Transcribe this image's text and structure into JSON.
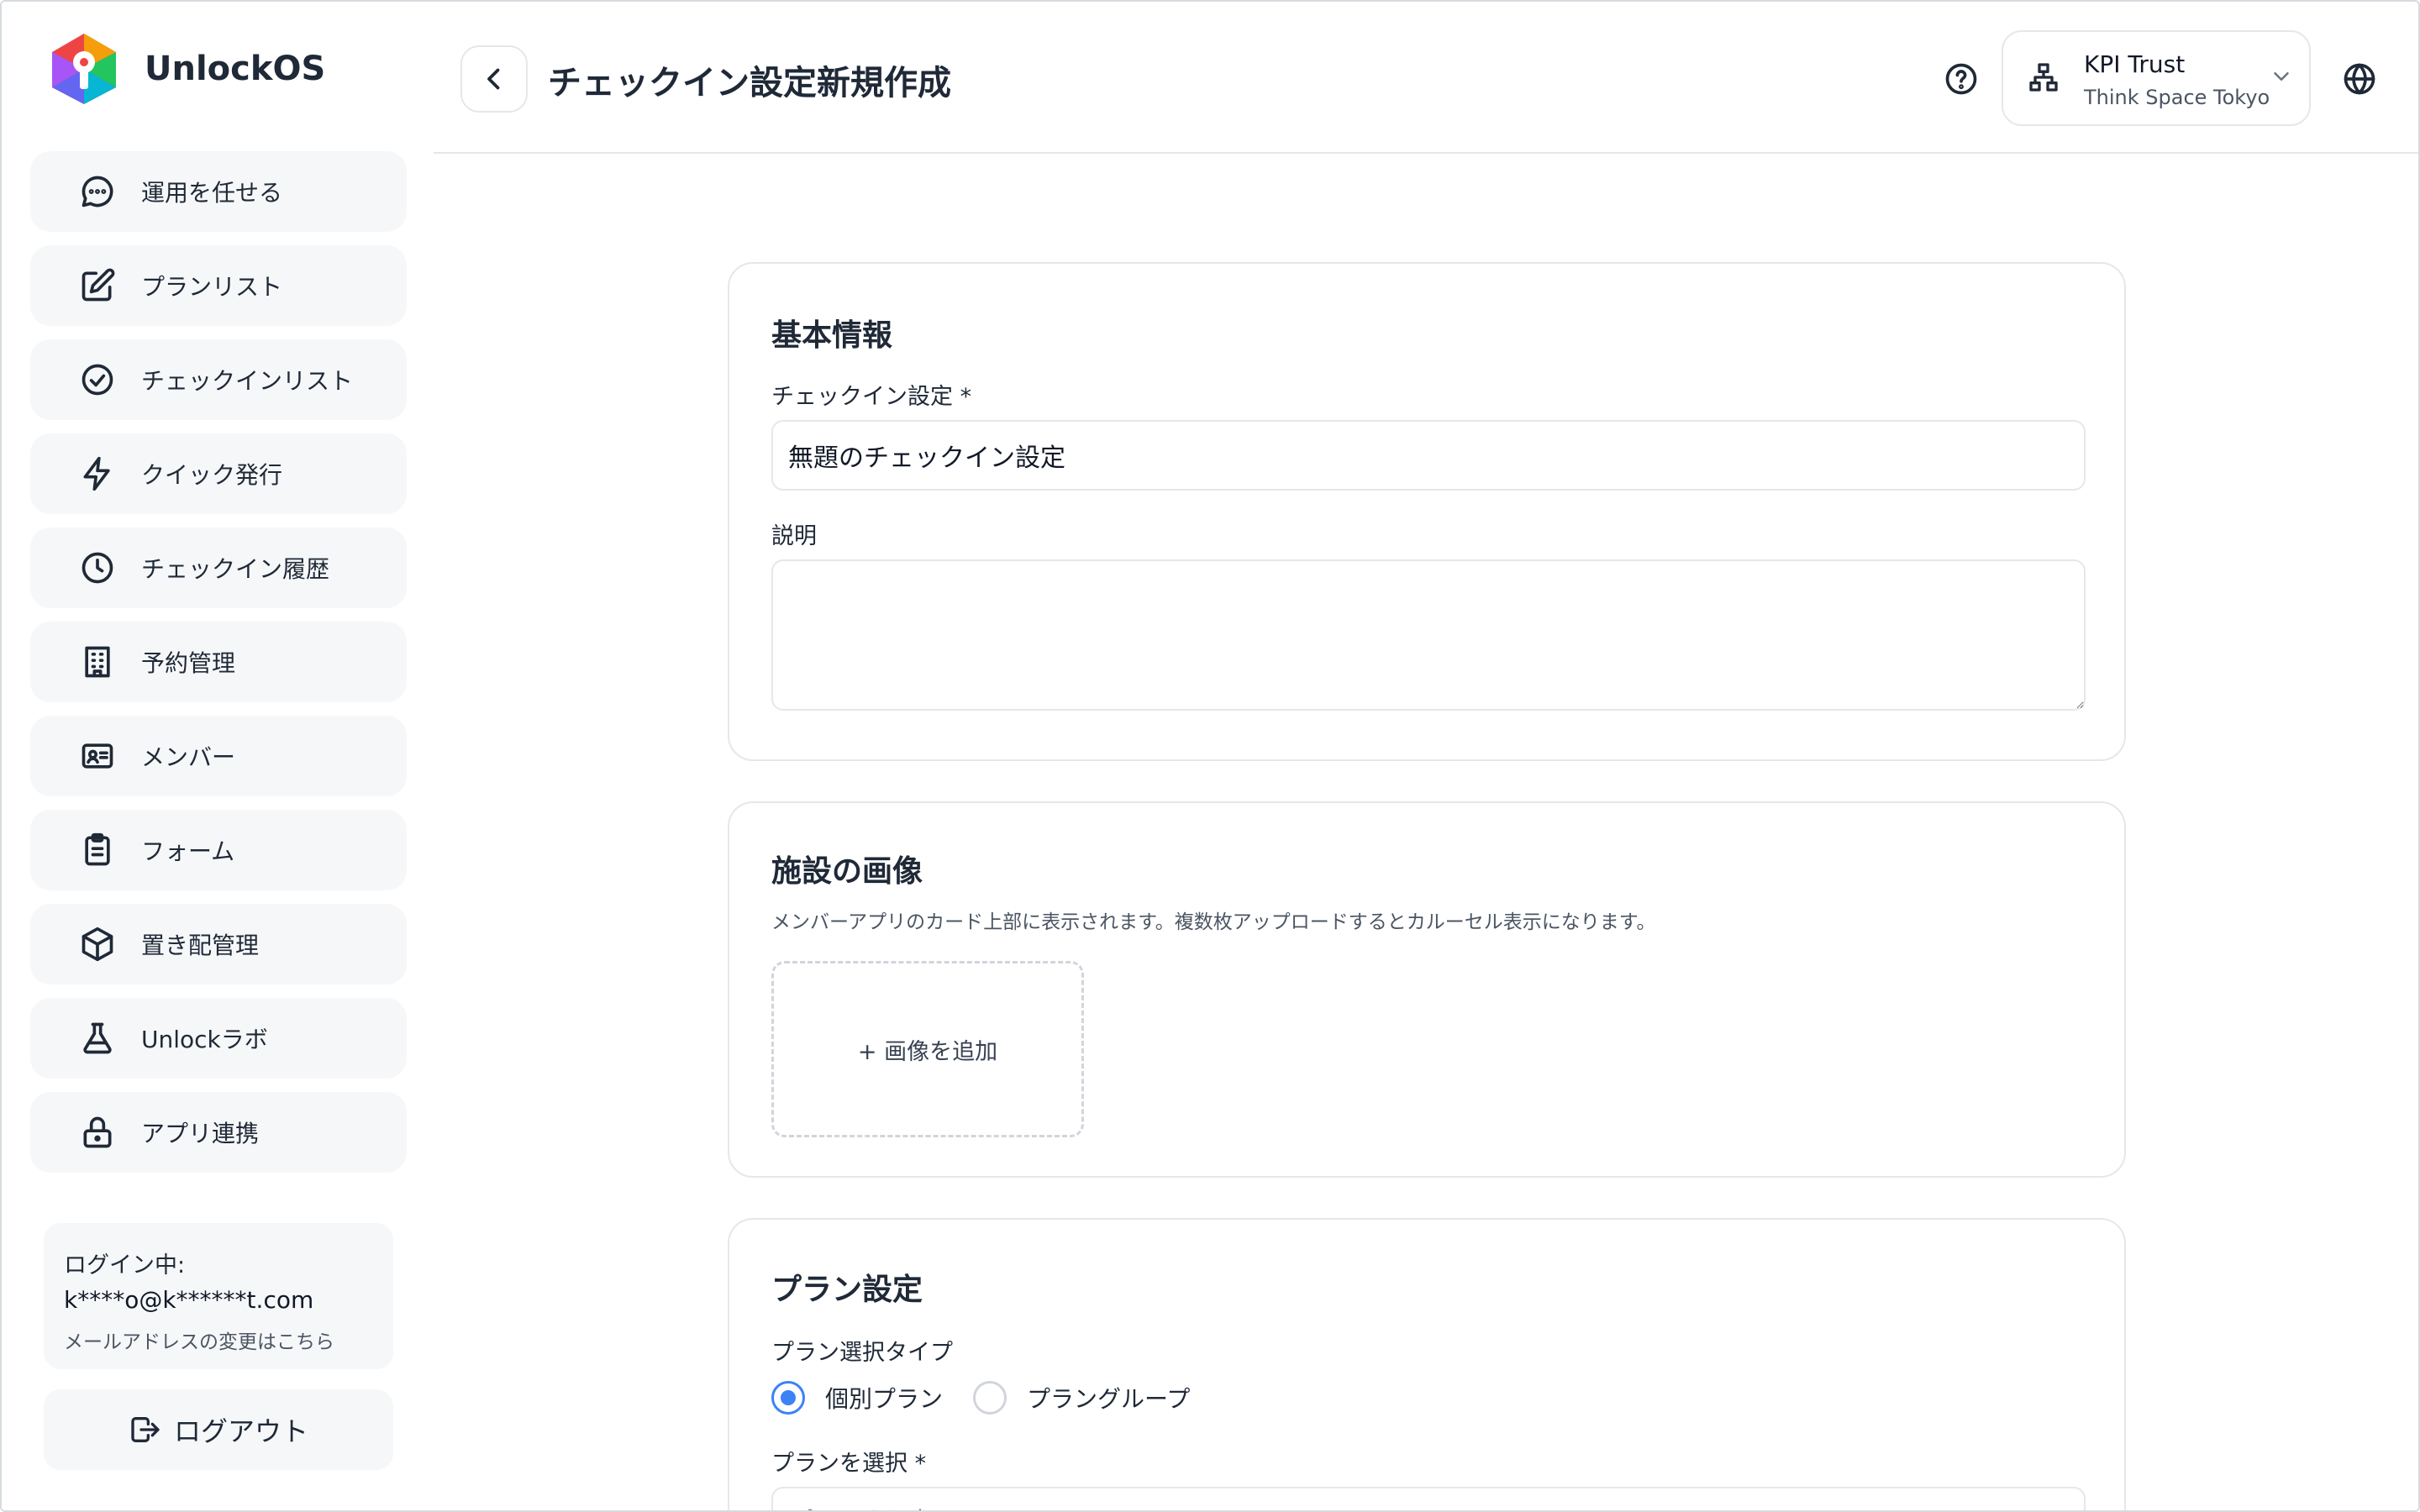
{
  "app": {
    "name": "UnlockOS"
  },
  "sidebar": {
    "items": [
      {
        "label": "運用を任せる",
        "icon": "chat-bubble-icon"
      },
      {
        "label": "プランリスト",
        "icon": "edit-icon"
      },
      {
        "label": "チェックインリスト",
        "icon": "check-circle-icon"
      },
      {
        "label": "クイック発行",
        "icon": "lightning-icon"
      },
      {
        "label": "チェックイン履歴",
        "icon": "clock-icon"
      },
      {
        "label": "予約管理",
        "icon": "building-icon"
      },
      {
        "label": "メンバー",
        "icon": "id-card-icon"
      },
      {
        "label": "フォーム",
        "icon": "clipboard-icon"
      },
      {
        "label": "置き配管理",
        "icon": "package-icon"
      },
      {
        "label": "Unlockラボ",
        "icon": "flask-icon"
      },
      {
        "label": "アプリ連携",
        "icon": "lock-icon"
      }
    ],
    "login": {
      "label": "ログイン中:",
      "email": "k****o@k******t.com",
      "change_link": "メールアドレスの変更はこちら"
    },
    "logout_label": "ログアウト"
  },
  "header": {
    "title": "チェックイン設定新規作成",
    "org_name": "KPI Trust",
    "org_sub": "Think Space Tokyo"
  },
  "basic_info": {
    "title": "基本情報",
    "checkin_label": "チェックイン設定 *",
    "checkin_value": "無題のチェックイン設定",
    "description_label": "説明",
    "description_value": ""
  },
  "images": {
    "title": "施設の画像",
    "description": "メンバーアプリのカード上部に表示されます。複数枚アップロードするとカルーセル表示になります。",
    "add_label": "+ 画像を追加"
  },
  "plan": {
    "title": "プラン設定",
    "type_label": "プラン選択タイプ",
    "options": [
      {
        "label": "個別プラン",
        "selected": true
      },
      {
        "label": "プラングループ",
        "selected": false
      }
    ],
    "select_label": "プランを選択 *",
    "select_placeholder": "プランを選択"
  },
  "colors": {
    "accent": "#3b82f6",
    "nav_bg": "#f6f7f9",
    "border": "#e5e7eb"
  }
}
